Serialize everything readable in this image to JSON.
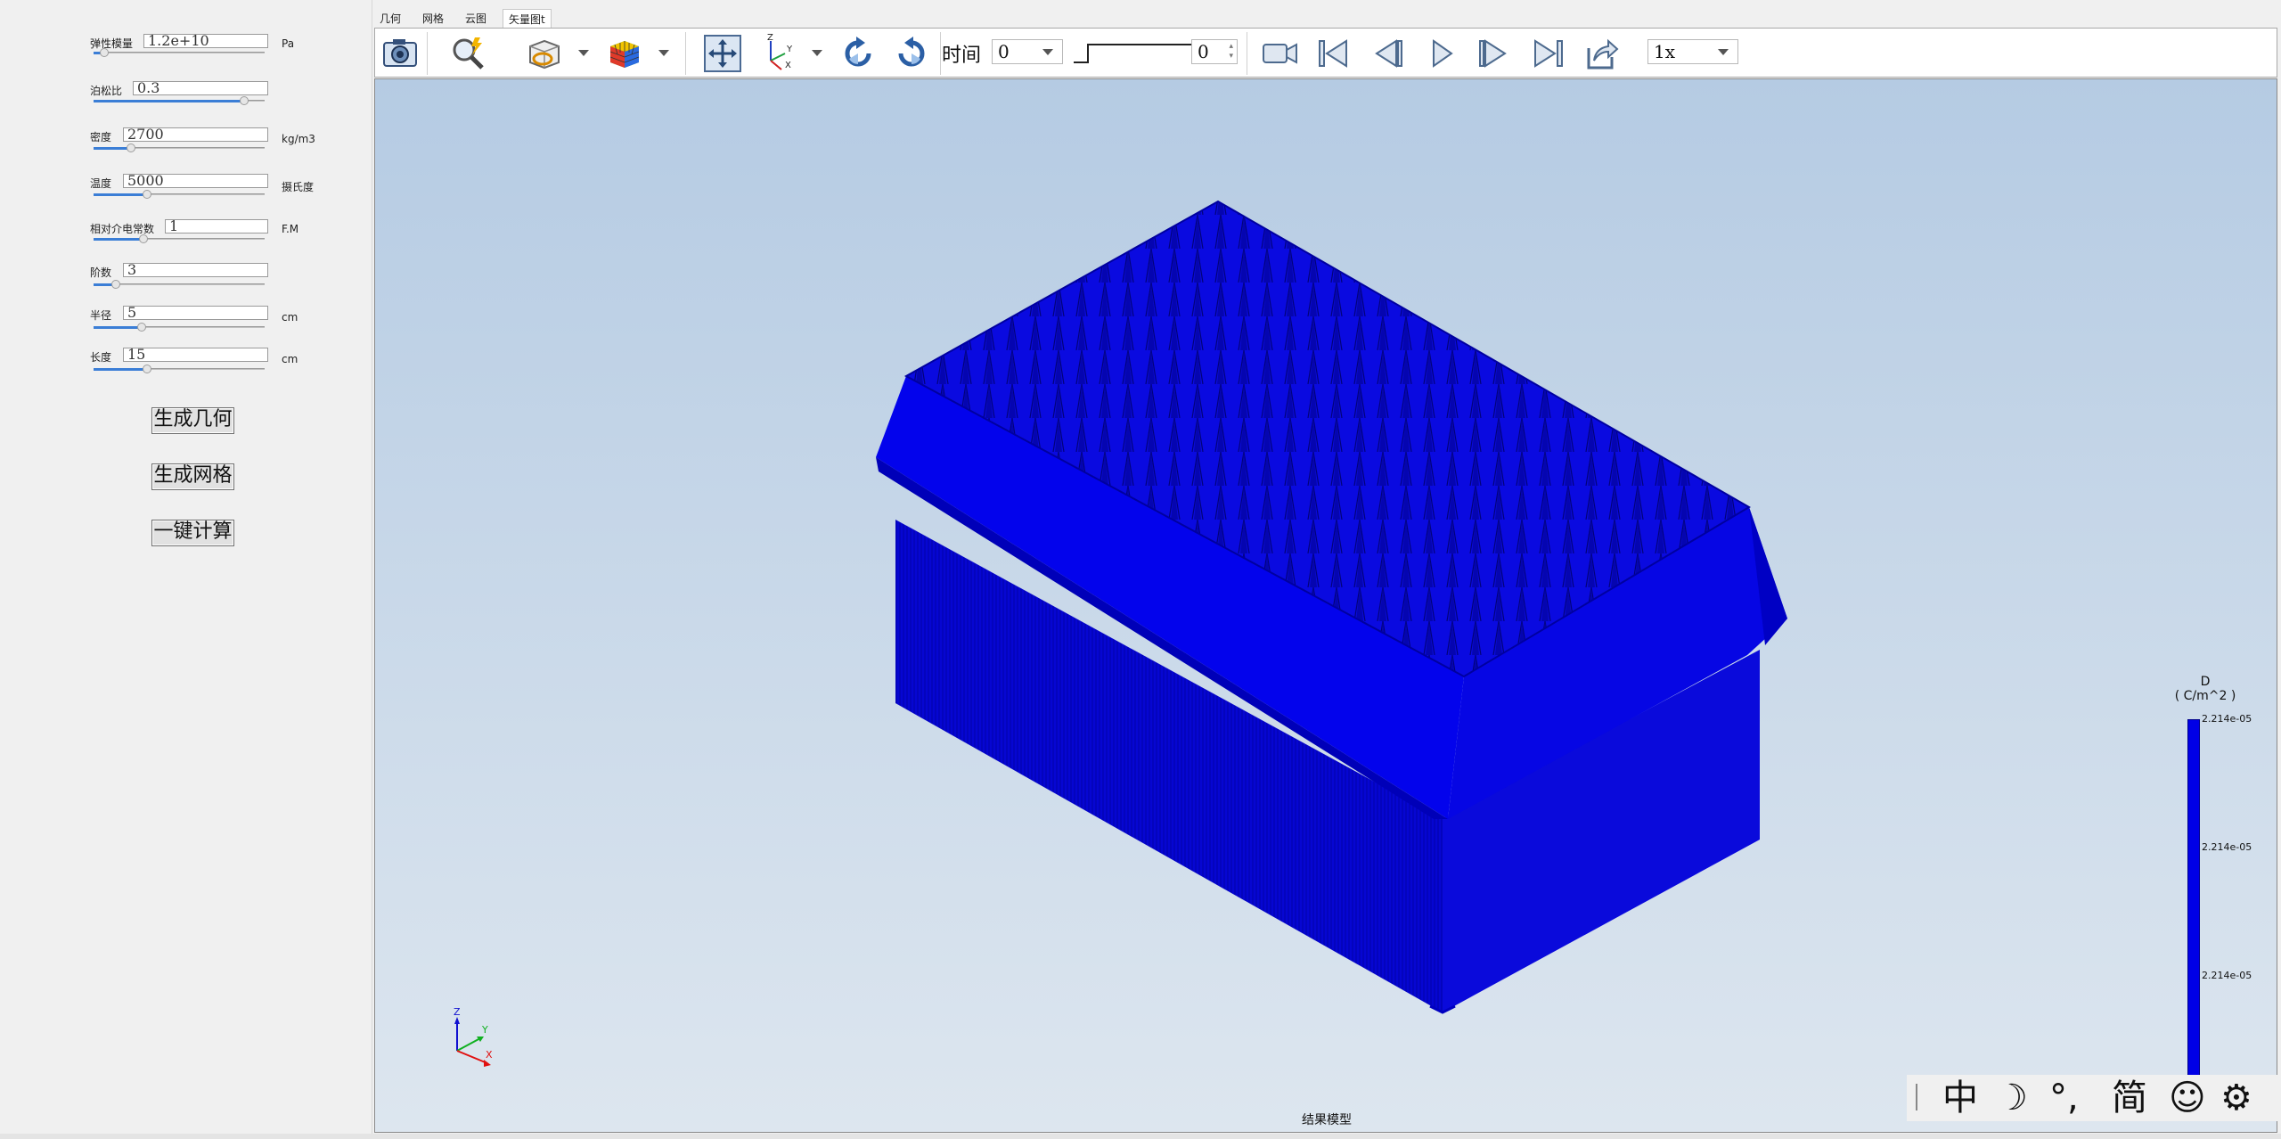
{
  "params": [
    {
      "label": "弹性模量",
      "value": "1.2e+10",
      "unit": "Pa",
      "slider": 0.06
    },
    {
      "label": "泊松比",
      "value": "0.3",
      "unit": "",
      "slider": 0.88
    },
    {
      "label": "密度",
      "value": "2700",
      "unit": "kg/m3",
      "slider": 0.22
    },
    {
      "label": "温度",
      "value": "5000",
      "unit": "摄氏度",
      "slider": 0.31
    },
    {
      "label": "相对介电常数",
      "value": "1",
      "unit": "F.M",
      "slider": 0.29
    },
    {
      "label": "阶数",
      "value": "3",
      "unit": "",
      "slider": 0.13
    },
    {
      "label": "半径",
      "value": "5",
      "unit": "cm",
      "slider": 0.28
    },
    {
      "label": "长度",
      "value": "15",
      "unit": "cm",
      "slider": 0.31
    }
  ],
  "buttons": {
    "generate_geometry": "生成几何",
    "generate_mesh": "生成网格",
    "one_click_compute": "一键计算"
  },
  "tabs": [
    "几何",
    "网格",
    "云图",
    "矢量图t"
  ],
  "active_tab": 3,
  "toolbar": {
    "time_label": "时间",
    "time_value": "0",
    "frame_value": "0",
    "speed_value": "1x"
  },
  "viewport": {
    "caption": "结果模型",
    "axes": {
      "z": "Z",
      "y": "Y",
      "x": "X"
    },
    "toolbar_axes": {
      "z": "Z",
      "y": "Y",
      "x": "X"
    }
  },
  "legend": {
    "variable": "D",
    "unit": "( C/m^2 )",
    "ticks": [
      "2.214e-05",
      "2.214e-05",
      "2.214e-05"
    ],
    "color": "#0000e6"
  },
  "ime": {
    "items": [
      "中",
      "☽",
      "°,",
      "简",
      "☺",
      "⚙"
    ]
  }
}
